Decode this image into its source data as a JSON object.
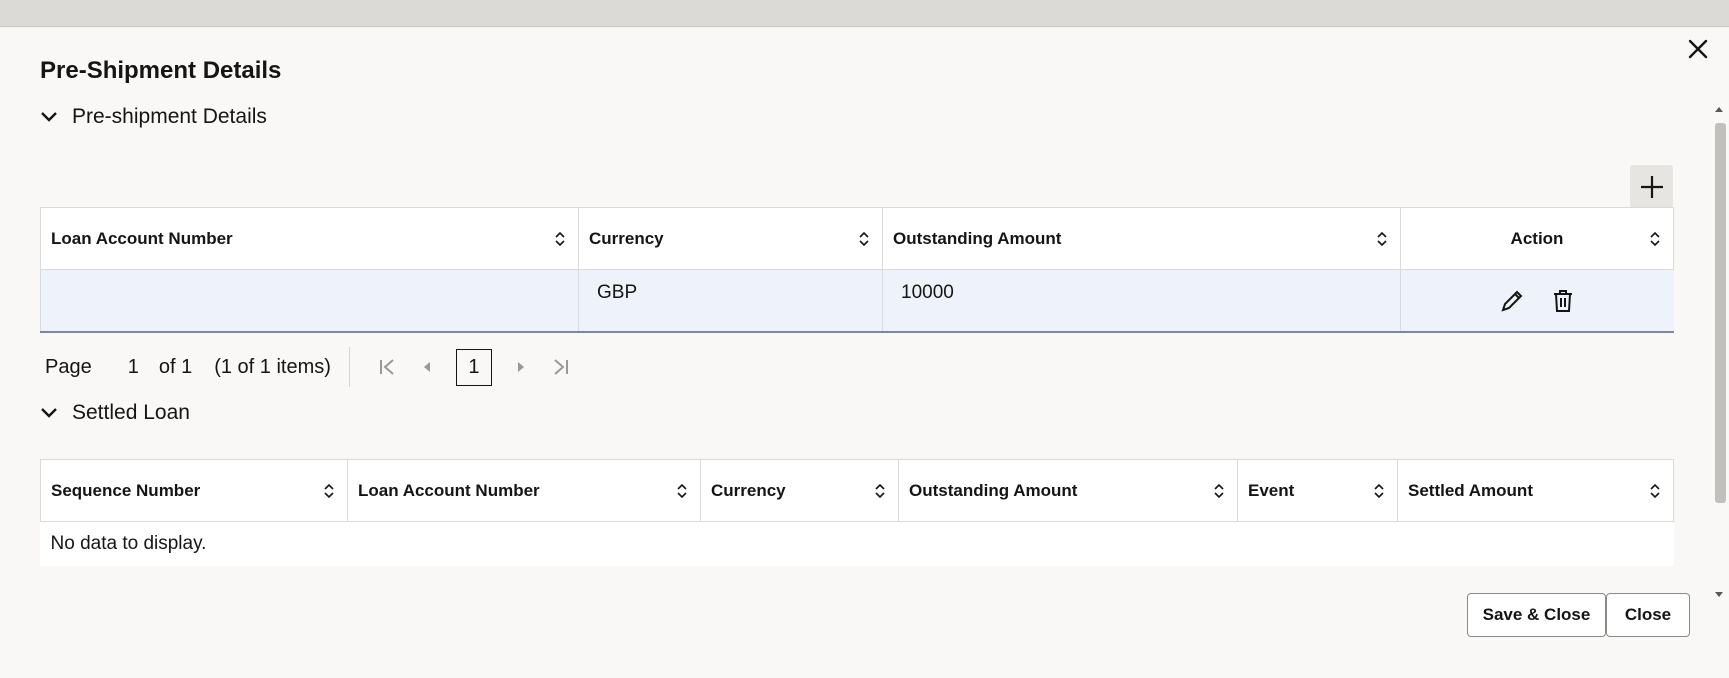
{
  "dialog": {
    "title": "Pre-Shipment Details"
  },
  "preshipment": {
    "section_title": "Pre-shipment Details",
    "columns": [
      "Loan Account Number",
      "Currency",
      "Outstanding Amount",
      "Action"
    ],
    "rows": [
      {
        "loan_account_number": "",
        "currency": "GBP",
        "outstanding_amount": "10000"
      }
    ],
    "pager": {
      "page_label": "Page",
      "page": "1",
      "of_label": "of 1",
      "items_label": "(1 of 1 items)",
      "current_page": "1"
    }
  },
  "settled": {
    "section_title": "Settled Loan",
    "columns": [
      "Sequence Number",
      "Loan Account Number",
      "Currency",
      "Outstanding Amount",
      "Event",
      "Settled Amount"
    ],
    "empty_text": "No data to display."
  },
  "footer": {
    "save_close_label": "Save & Close",
    "close_label": "Close"
  },
  "icons": {
    "close": "close-icon",
    "add": "plus-icon",
    "edit": "pencil-icon",
    "delete": "trash-icon",
    "sort": "sort-icon",
    "collapse": "chevron-down-icon"
  }
}
